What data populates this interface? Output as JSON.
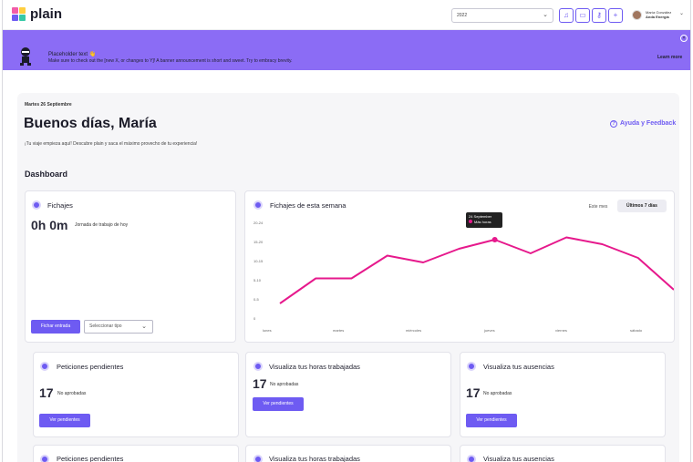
{
  "app": {
    "brand": "plain"
  },
  "topbar": {
    "year": "2022",
    "user_name": "María González",
    "user_company": "Anda Energía"
  },
  "banner": {
    "title": "Placeholder text 👋",
    "text": "Make sure to check out the [new X, or changes to Y]! A banner announcement is short and sweet. Try to embracy brevity.",
    "learn_more": "Learn more"
  },
  "header": {
    "date": "Martes 26 Septiembre",
    "greeting": "Buenos días, María",
    "help": "Ayuda y Feedback",
    "subtitle": "¡Tu viaje empieza aquí! Descubre plain y saca el máximo provecho de tu experiencia!",
    "section": "Dashboard"
  },
  "fichajes": {
    "title": "Fichajes",
    "hours": "0h 0m",
    "hours_label": "Jornada de trabajo de hoy",
    "button": "Fichar entrada",
    "select_placeholder": "Seleccionar tipo"
  },
  "week": {
    "title": "Fichajes de esta semana",
    "tab_month": "Este mes",
    "tab_week": "Últimos 7 días",
    "tooltip_date": "24 September",
    "tooltip_label": "Más horas"
  },
  "chart_data": {
    "type": "line",
    "title": "Fichajes de esta semana",
    "x": [
      "lunes",
      "martes",
      "miércoles",
      "jueves",
      "viernes",
      "sábado"
    ],
    "yticks": [
      "0",
      "0-5",
      "5-10",
      "10-15",
      "15-20",
      "20-24"
    ],
    "series": [
      {
        "values": [
          2,
          7.5,
          7.5,
          12.5,
          11,
          14,
          16,
          13,
          16.5,
          15,
          12,
          5
        ]
      }
    ],
    "line_color": "#e6198c",
    "ylim": [
      0,
      20
    ]
  },
  "cards": [
    {
      "title": "Peticiones pendientes",
      "count": "17",
      "label": "No aprobadas",
      "button": "Ver pendientes"
    },
    {
      "title": "Visualiza tus horas trabajadas",
      "count": "17",
      "label": "No aprobadas",
      "button": "Ver pendientes"
    },
    {
      "title": "Visualiza tus ausencias",
      "count": "17",
      "label": "No aprobadas",
      "button": "Ver pendientes"
    },
    {
      "title": "Peticiones pendientes"
    },
    {
      "title": "Visualiza tus horas trabajadas"
    },
    {
      "title": "Visualiza tus ausencias"
    }
  ],
  "colors": {
    "accent": "#6e5bf2",
    "banner": "#8b6cf5",
    "chart_line": "#e6198c"
  }
}
